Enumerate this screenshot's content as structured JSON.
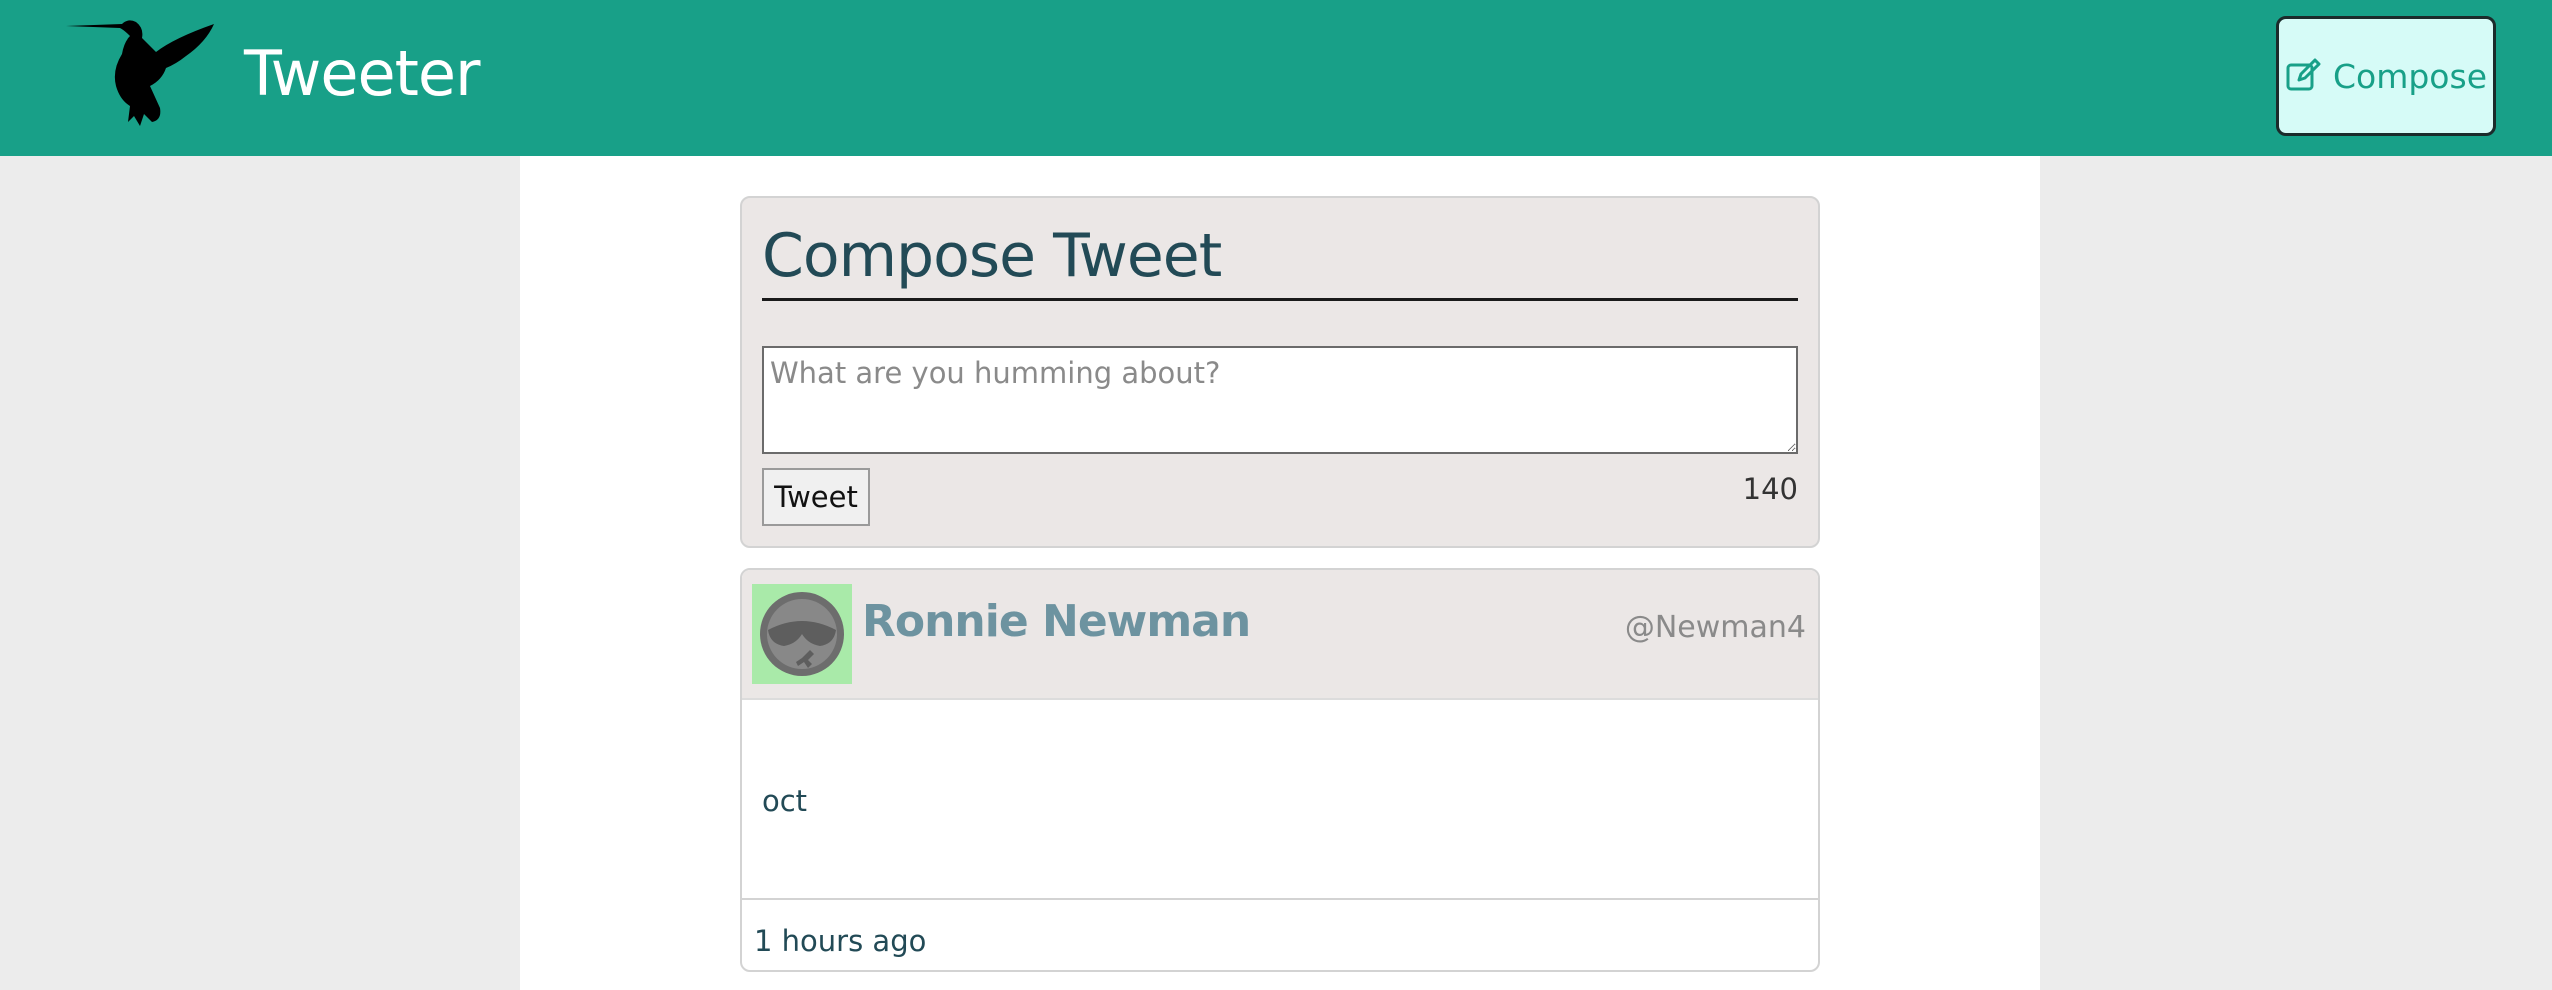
{
  "header": {
    "app_title": "Tweeter",
    "logo_icon": "hummingbird-icon",
    "compose_label": "Compose",
    "compose_icon": "edit-icon"
  },
  "compose": {
    "heading": "Compose Tweet",
    "placeholder": "What are you humming about?",
    "submit_label": "Tweet",
    "char_count": "140"
  },
  "tweets": [
    {
      "author_name": "Ronnie Newman",
      "handle": "@Newman4",
      "content": "oct",
      "time": "1 hours ago",
      "avatar_icon": "avatar-sunglasses-icon"
    }
  ],
  "colors": {
    "accent": "#18a088",
    "page_bg": "#ececec",
    "panel_bg": "#ebe7e6",
    "heading_text": "#224a56",
    "author_name": "#6d93a0",
    "compose_button_bg": "#d6fbf7"
  }
}
